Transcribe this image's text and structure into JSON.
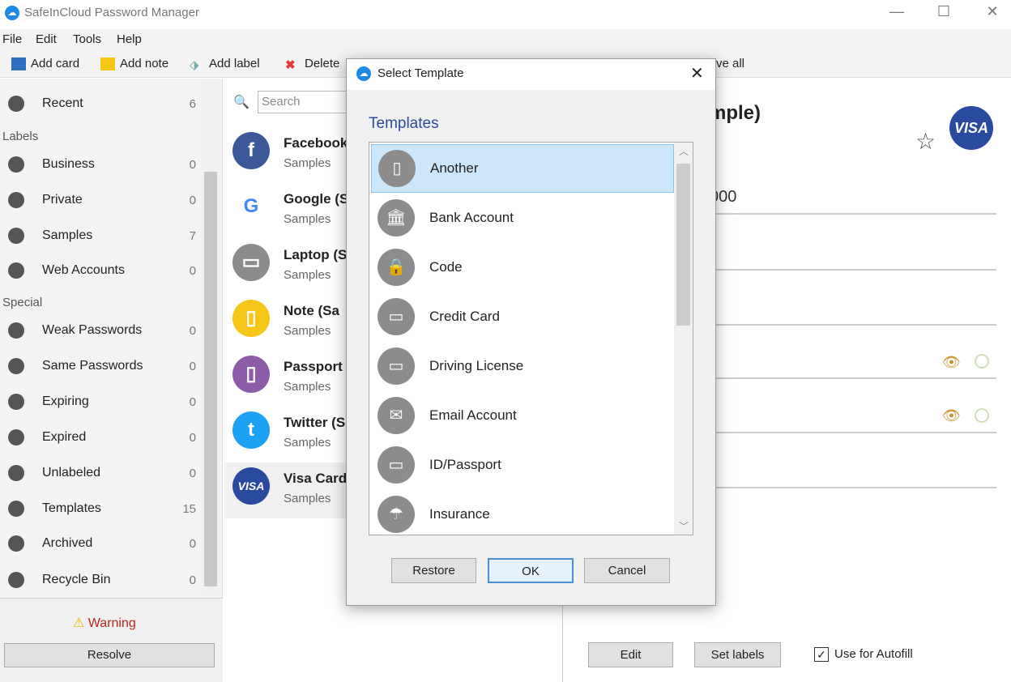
{
  "window": {
    "title": "SafeInCloud Password Manager",
    "minimize": "—",
    "maximize": "☐",
    "close": "✕"
  },
  "menu": [
    "File",
    "Edit",
    "Tools",
    "Help"
  ],
  "toolbar": {
    "add_card": "Add card",
    "add_note": "Add note",
    "add_label": "Add label",
    "delete": "Delete",
    "save_all": "ve all"
  },
  "sidebar": {
    "items": [
      {
        "label": "Recent",
        "count": "6",
        "icon": "clock-icon"
      },
      {
        "header": "Labels"
      },
      {
        "label": "Business",
        "count": "0",
        "icon": "tag-icon"
      },
      {
        "label": "Private",
        "count": "0",
        "icon": "tag-icon"
      },
      {
        "label": "Samples",
        "count": "7",
        "icon": "tag-icon"
      },
      {
        "label": "Web Accounts",
        "count": "0",
        "icon": "tag-icon"
      },
      {
        "header": "Special"
      },
      {
        "label": "Weak Passwords",
        "count": "0",
        "icon": "exclamation-icon"
      },
      {
        "label": "Same Passwords",
        "count": "0",
        "icon": "exclamation-icon"
      },
      {
        "label": "Expiring",
        "count": "0",
        "icon": "clock-icon"
      },
      {
        "label": "Expired",
        "count": "0",
        "icon": "clock-icon"
      },
      {
        "label": "Unlabeled",
        "count": "0",
        "icon": "untag-icon"
      },
      {
        "label": "Templates",
        "count": "15",
        "icon": "templates-icon"
      },
      {
        "label": "Archived",
        "count": "0",
        "icon": "folder-icon"
      },
      {
        "label": "Recycle Bin",
        "count": "0",
        "icon": "trash-icon"
      }
    ],
    "warning": "Warning",
    "resolve": "Resolve"
  },
  "search": {
    "placeholder": "Search"
  },
  "cards": [
    {
      "name": "Facebook",
      "sub": "Samples",
      "color": "#3b5998",
      "glyph": "f"
    },
    {
      "name": "Google (S",
      "sub": "Samples",
      "color": "#ffffff",
      "glyph": "G"
    },
    {
      "name": "Laptop (S",
      "sub": "Samples",
      "color": "#8c8c8c",
      "glyph": "▭"
    },
    {
      "name": "Note (Sa",
      "sub": "Samples",
      "color": "#f5c518",
      "glyph": "▯"
    },
    {
      "name": "Passport",
      "sub": "Samples",
      "color": "#8e5ba8",
      "glyph": "▯"
    },
    {
      "name": "Twitter (S",
      "sub": "Samples",
      "color": "#1da1f2",
      "glyph": "t"
    },
    {
      "name": "Visa Card",
      "sub": "Samples",
      "color": "#2a4aa0",
      "glyph": "VISA"
    }
  ],
  "detail": {
    "title": "mple)",
    "value": "000",
    "visa": "VISA",
    "edit": "Edit",
    "set_labels": "Set labels",
    "autofill": "Use for Autofill",
    "autofill_checked": true
  },
  "dialog": {
    "title": "Select Template",
    "heading": "Templates",
    "templates": [
      {
        "label": "Another",
        "glyph": "▯",
        "selected": true
      },
      {
        "label": "Bank Account",
        "glyph": "🏛"
      },
      {
        "label": "Code",
        "glyph": "🔒"
      },
      {
        "label": "Credit Card",
        "glyph": "▭"
      },
      {
        "label": "Driving License",
        "glyph": "▭"
      },
      {
        "label": "Email Account",
        "glyph": "✉"
      },
      {
        "label": "ID/Passport",
        "glyph": "▭"
      },
      {
        "label": "Insurance",
        "glyph": "☂"
      }
    ],
    "restore": "Restore",
    "ok": "OK",
    "cancel": "Cancel"
  },
  "colors": {
    "accent": "#1e88e5",
    "selection": "#cce6fb",
    "warning": "#b22222"
  }
}
